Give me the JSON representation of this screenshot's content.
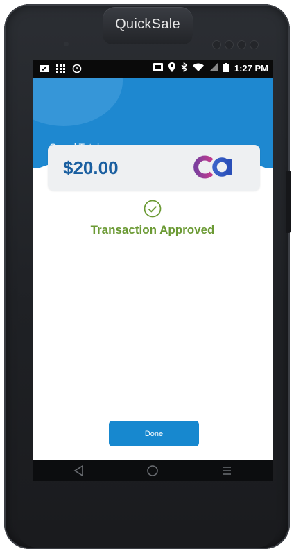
{
  "device": {
    "brand": "QuickSale"
  },
  "statusbar": {
    "time": "1:27 PM"
  },
  "payment": {
    "grand_total_label": "Grand Total:",
    "amount": "$20.00",
    "status": "Transaction Approved"
  },
  "actions": {
    "done_label": "Done"
  },
  "colors": {
    "accent": "#1e88d0",
    "approved": "#6b9a34",
    "amount": "#1a5fa0"
  },
  "icons": [
    "notification-icon",
    "grid-icon",
    "clock-icon",
    "cast-icon",
    "location-icon",
    "bluetooth-icon",
    "wifi-icon",
    "signal-icon",
    "battery-icon",
    "check-circle-icon",
    "back-icon",
    "home-icon",
    "menu-icon",
    "ca-logo"
  ]
}
